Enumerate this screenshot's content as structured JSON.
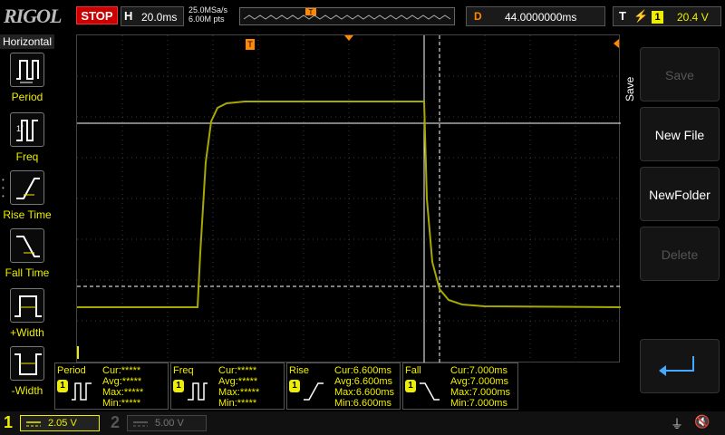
{
  "header": {
    "logo": "RIGOL",
    "run_state": "STOP",
    "horizontal_label": "H",
    "timebase": "20.0ms",
    "sample_rate": "25.0MSa/s",
    "memory_depth": "6.00M pts",
    "delay_label": "D",
    "delay_value": "44.0000000ms",
    "trigger_label": "T",
    "trigger_channel": "1",
    "trigger_level": "20.4 V"
  },
  "left_menu": {
    "title": "Horizontal",
    "items": [
      {
        "label": "Period"
      },
      {
        "label": "Freq"
      },
      {
        "label": "Rise Time"
      },
      {
        "label": "Fall Time"
      },
      {
        "label": "+Width"
      },
      {
        "label": "-Width"
      }
    ]
  },
  "right_menu": {
    "title": "Save",
    "buttons": [
      {
        "label": "Save",
        "enabled": false
      },
      {
        "label": "New File",
        "enabled": true
      },
      {
        "label": "NewFolder",
        "enabled": true
      },
      {
        "label": "Delete",
        "enabled": false
      }
    ]
  },
  "measurements": [
    {
      "name": "Period",
      "channel": "1",
      "cur": "Cur:*****",
      "avg": "Avg:*****",
      "max": "Max:*****",
      "min": "Min:*****"
    },
    {
      "name": "Freq",
      "channel": "1",
      "cur": "Cur:*****",
      "avg": "Avg:*****",
      "max": "Max:*****",
      "min": "Min:*****"
    },
    {
      "name": "Rise",
      "channel": "1",
      "cur": "Cur:6.600ms",
      "avg": "Avg:6.600ms",
      "max": "Max:6.600ms",
      "min": "Min:6.600ms"
    },
    {
      "name": "Fall",
      "channel": "1",
      "cur": "Cur:7.000ms",
      "avg": "Avg:7.000ms",
      "max": "Max:7.000ms",
      "min": "Min:7.000ms"
    }
  ],
  "channels": {
    "ch1": {
      "number": "1",
      "scale": "2.05 V"
    },
    "ch2": {
      "number": "2",
      "scale": "5.00 V"
    }
  },
  "colors": {
    "ch1": "#e8e800",
    "trace": "#a8a800",
    "stop": "#cc0000",
    "delay": "#ff8800"
  }
}
